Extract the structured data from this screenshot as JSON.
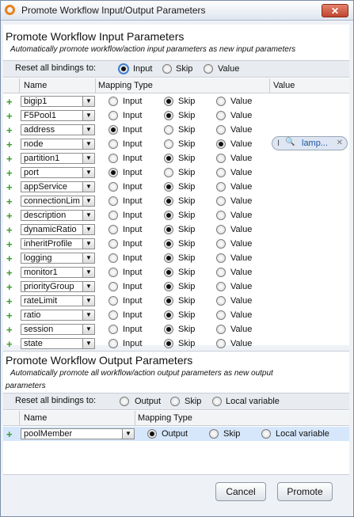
{
  "window": {
    "title": "Promote Workflow Input/Output Parameters",
    "close_glyph": "✕"
  },
  "input_section": {
    "title": "Promote Workflow Input Parameters",
    "subtitle": "Automatically promote workflow/action input parameters as new input parameters",
    "reset_label": "Reset all bindings to:",
    "reset_options": [
      "Input",
      "Skip",
      "Value"
    ],
    "reset_selected": "Input",
    "columns": {
      "name": "Name",
      "mapping": "Mapping Type",
      "value": "Value"
    },
    "option_labels": [
      "Input",
      "Skip",
      "Value"
    ],
    "rows": [
      {
        "name": "bigip1",
        "mapping": "Skip"
      },
      {
        "name": "F5Pool1",
        "mapping": "Skip"
      },
      {
        "name": "address",
        "mapping": "Input"
      },
      {
        "name": "node",
        "mapping": "Value",
        "value": "lamp..."
      },
      {
        "name": "partition1",
        "mapping": "Skip"
      },
      {
        "name": "port",
        "mapping": "Input"
      },
      {
        "name": "appService",
        "mapping": "Skip"
      },
      {
        "name": "connectionLim",
        "mapping": "Skip"
      },
      {
        "name": "description",
        "mapping": "Skip"
      },
      {
        "name": "dynamicRatio",
        "mapping": "Skip"
      },
      {
        "name": "inheritProfile",
        "mapping": "Skip"
      },
      {
        "name": "logging",
        "mapping": "Skip"
      },
      {
        "name": "monitor1",
        "mapping": "Skip"
      },
      {
        "name": "priorityGroup",
        "mapping": "Skip"
      },
      {
        "name": "rateLimit",
        "mapping": "Skip"
      },
      {
        "name": "ratio",
        "mapping": "Skip"
      },
      {
        "name": "session",
        "mapping": "Skip"
      },
      {
        "name": "state",
        "mapping": "Skip"
      }
    ]
  },
  "output_section": {
    "title": "Promote Workflow Output Parameters",
    "subtitle_line1": "Automatically promote all workflow/action output parameters as new output",
    "subtitle_line2": "parameters",
    "reset_label": "Reset all bindings to:",
    "reset_options": [
      "Output",
      "Skip",
      "Local variable"
    ],
    "columns": {
      "name": "Name",
      "mapping": "Mapping Type"
    },
    "rows": [
      {
        "name": "poolMember",
        "mapping": "Output"
      }
    ]
  },
  "tag": {
    "text": "lamp...",
    "prefix": "I",
    "search_glyph": "🔍",
    "remove_glyph": "✕"
  },
  "buttons": {
    "cancel": "Cancel",
    "promote": "Promote"
  },
  "icons": {
    "add": "+",
    "dropdown": "▼"
  },
  "colors": {
    "accent_green": "#3d9a2c",
    "selected_row": "#d6e7fb",
    "link_blue": "#2156a6"
  }
}
